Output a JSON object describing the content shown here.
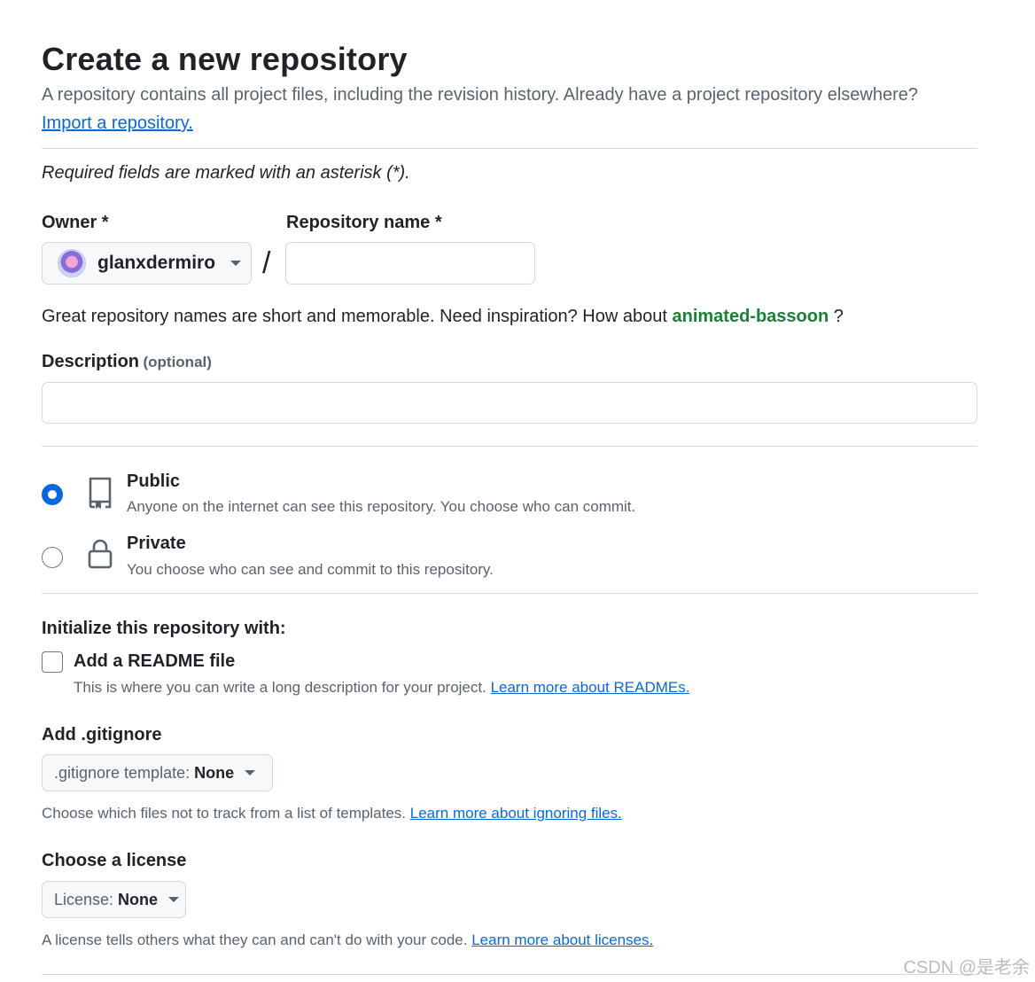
{
  "page": {
    "title": "Create a new repository",
    "subtitle": "A repository contains all project files, including the revision history. Already have a project repository elsewhere?",
    "import_link": "Import a repository.",
    "required_note": "Required fields are marked with an asterisk (*)."
  },
  "owner": {
    "label": "Owner *",
    "value": "glanxdermiro",
    "avatar_icon": "avatar-icon"
  },
  "repo_name": {
    "label": "Repository name *",
    "value": "",
    "separator": "/"
  },
  "suggestion": {
    "text": "Great repository names are short and memorable. Need inspiration? How about",
    "name": "animated-bassoon",
    "suffix": "?"
  },
  "description": {
    "label": "Description",
    "optional": "(optional)",
    "value": ""
  },
  "visibility": {
    "options": [
      {
        "label": "Public",
        "desc": "Anyone on the internet can see this repository. You choose who can commit.",
        "selected": true,
        "icon": "repo-icon"
      },
      {
        "label": "Private",
        "desc": "You choose who can see and commit to this repository.",
        "selected": false,
        "icon": "lock-icon"
      }
    ]
  },
  "init": {
    "heading": "Initialize this repository with:",
    "readme_label": "Add a README file",
    "readme_desc": "This is where you can write a long description for your project.",
    "readme_link": "Learn more about READMEs.",
    "readme_checked": false
  },
  "gitignore": {
    "heading": "Add .gitignore",
    "button_prefix": ".gitignore template:",
    "button_value": "None",
    "desc": "Choose which files not to track from a list of templates.",
    "link": "Learn more about ignoring files."
  },
  "license": {
    "heading": "Choose a license",
    "button_prefix": "License:",
    "button_value": "None",
    "desc": "A license tells others what they can and can't do with your code.",
    "link": "Learn more about licenses."
  },
  "watermark": "CSDN @是老余",
  "colors": {
    "accent": "#0969da",
    "radio": "#0969da",
    "suggestion": "#1a7f37",
    "border": "#d1d9e0",
    "muted": "#59636e"
  }
}
